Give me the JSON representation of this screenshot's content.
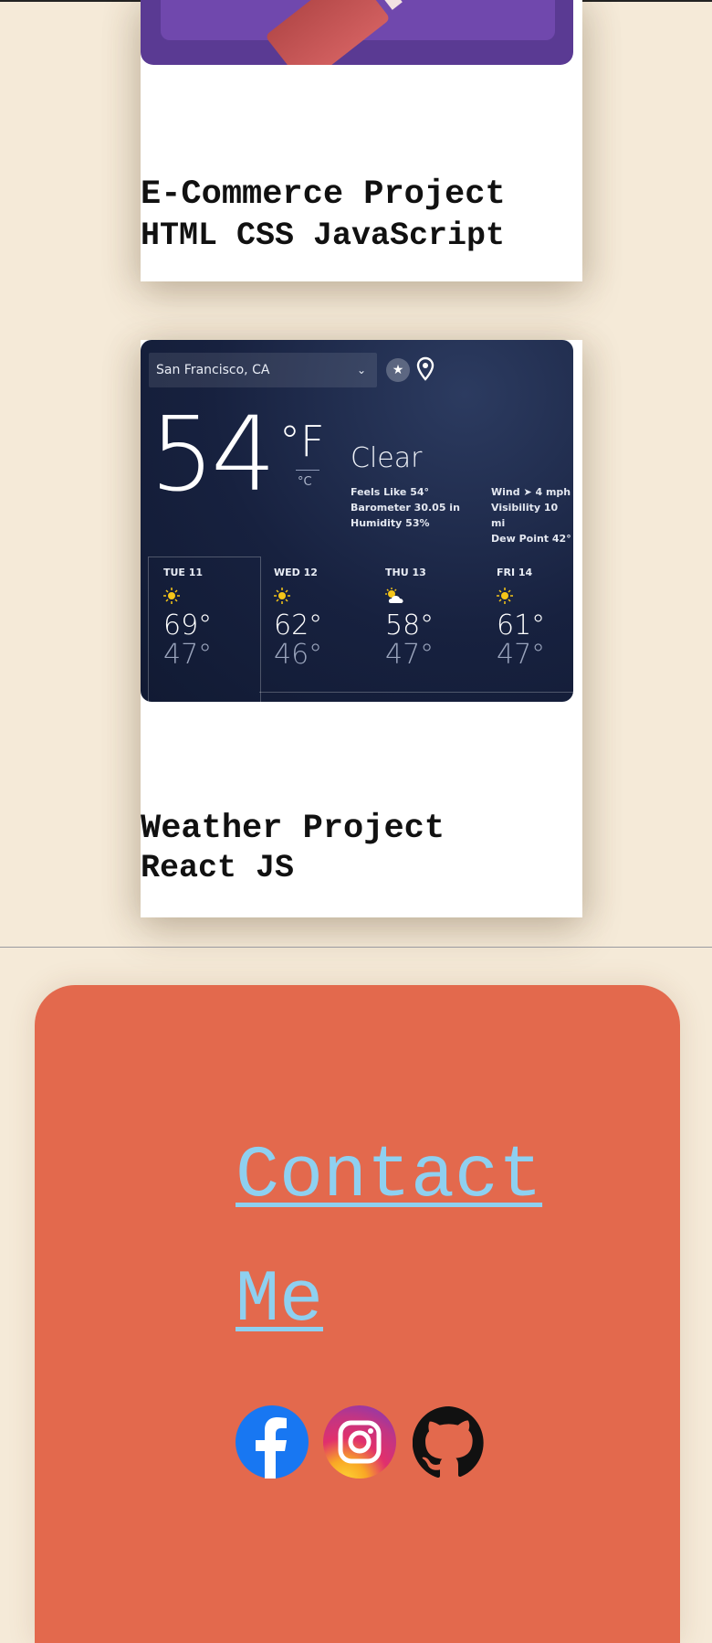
{
  "projects": [
    {
      "title": "E-Commerce Project",
      "tech": "HTML CSS JavaScript"
    },
    {
      "title": "Weather Project",
      "tech": "React JS",
      "screenshot": {
        "location": "San Francisco, CA",
        "temperature": "54",
        "unit_f": "°F",
        "unit_c": "°C",
        "condition": "Clear",
        "details_left": [
          "Feels Like 54°",
          "Barometer 30.05 in",
          "Humidity 53%"
        ],
        "details_right": [
          "Wind ➤ 4 mph",
          "Visibility 10 mi",
          "Dew Point 42°"
        ],
        "forecast": [
          {
            "day": "TUE 11",
            "high": "69°",
            "low": "47°",
            "icon": "sun-icon"
          },
          {
            "day": "WED 12",
            "high": "62°",
            "low": "46°",
            "icon": "sun-icon"
          },
          {
            "day": "THU 13",
            "high": "58°",
            "low": "47°",
            "icon": "partly-cloudy-icon"
          },
          {
            "day": "FRI 14",
            "high": "61°",
            "low": "47°",
            "icon": "sun-icon"
          }
        ]
      }
    }
  ],
  "contact": {
    "label": "Contact Me",
    "socials": [
      "facebook-icon",
      "instagram-icon",
      "github-icon"
    ]
  },
  "colors": {
    "page_bg": "#f5ead8",
    "contact_bg": "#e3694d",
    "link": "#8ed0f0"
  }
}
